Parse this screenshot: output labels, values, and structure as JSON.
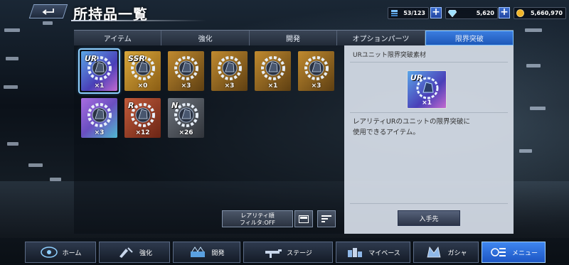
{
  "header": {
    "title": "所持品一覧",
    "resources": [
      {
        "name": "unit-capacity",
        "value": "53/123"
      },
      {
        "name": "gems",
        "value": "5,620"
      },
      {
        "name": "coins",
        "value": "5,660,970"
      }
    ]
  },
  "tabs": [
    {
      "label": "アイテム",
      "active": false
    },
    {
      "label": "強化",
      "active": false
    },
    {
      "label": "開発",
      "active": false
    },
    {
      "label": "オプションパーツ",
      "active": false
    },
    {
      "label": "限界突破",
      "active": true
    }
  ],
  "items": [
    {
      "rarity": "UR",
      "count": "×1",
      "selected": true,
      "style": "r-ur"
    },
    {
      "rarity": "SSR",
      "count": "×0",
      "selected": false,
      "style": "r-ssr"
    },
    {
      "rarity": "",
      "count": "×3",
      "selected": false,
      "style": "r-sr"
    },
    {
      "rarity": "",
      "count": "×3",
      "selected": false,
      "style": "r-sr"
    },
    {
      "rarity": "",
      "count": "×1",
      "selected": false,
      "style": "r-sr"
    },
    {
      "rarity": "",
      "count": "×3",
      "selected": false,
      "style": "r-sr"
    },
    {
      "rarity": "",
      "count": "×3",
      "selected": false,
      "style": "r-ur2"
    },
    {
      "rarity": "R",
      "count": "×12",
      "selected": false,
      "style": "r-r"
    },
    {
      "rarity": "N",
      "count": "×26",
      "selected": false,
      "style": "r-n"
    }
  ],
  "filter": {
    "line1": "レアリティ順",
    "line2": "フィルタ:OFF"
  },
  "detail": {
    "title": "URユニット限界突破素材",
    "icon_rarity": "UR",
    "icon_count": "×1",
    "description_line1": "レアリティURのユニットの限界突破に",
    "description_line2": "使用できるアイテム。",
    "obtain_label": "入手先"
  },
  "nav": [
    {
      "label": "ホーム",
      "icon": "home-icon",
      "active": false
    },
    {
      "label": "強化",
      "icon": "enhance-icon",
      "active": false
    },
    {
      "label": "開発",
      "icon": "develop-icon",
      "active": false
    },
    {
      "label": "ステージ",
      "icon": "stage-icon",
      "active": false
    },
    {
      "label": "マイベース",
      "icon": "mybase-icon",
      "active": false
    },
    {
      "label": "ガシャ",
      "icon": "gacha-icon",
      "active": false
    },
    {
      "label": "メニュー",
      "icon": "menu-icon",
      "active": true
    }
  ],
  "colors": {
    "accent": "#3b7de0",
    "ur": "#5aa6e8",
    "ssr": "#d9a73b",
    "r": "#c05a3a",
    "n": "#6d737c"
  }
}
